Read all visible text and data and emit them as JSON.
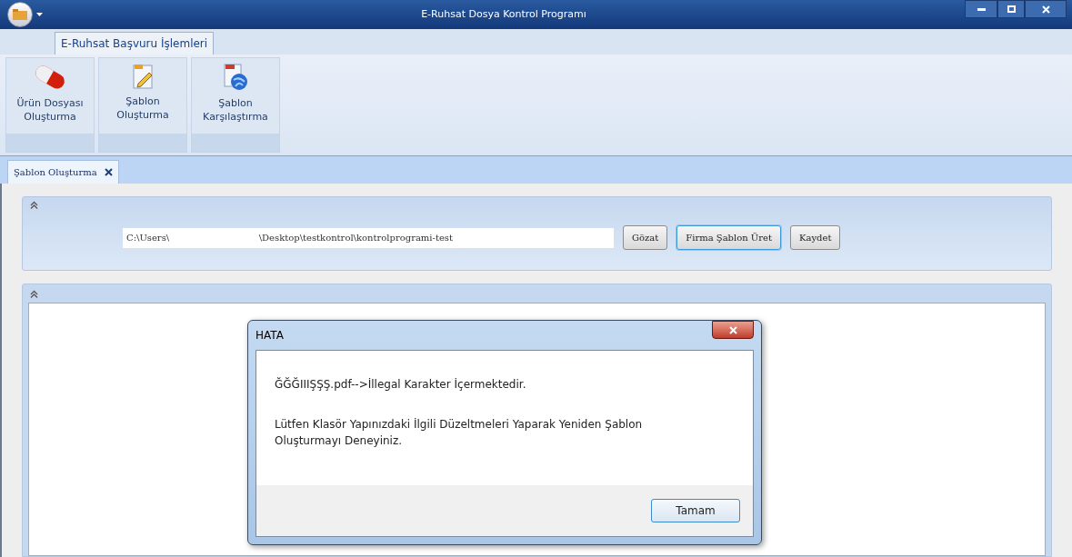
{
  "window": {
    "title": "E-Ruhsat Dosya Kontrol Programı"
  },
  "ribbon": {
    "tabs": [
      {
        "label": "E-Ruhsat Başvuru İşlemleri",
        "selected": true
      }
    ],
    "buttons": [
      {
        "label": "Ürün Dosyası Oluşturma",
        "kind": "pill"
      },
      {
        "label": "Şablon Oluşturma",
        "kind": "edit"
      },
      {
        "label": "Şablon Karşılaştırma",
        "kind": "globe"
      }
    ]
  },
  "doc_tabs": [
    {
      "label": "Şablon Oluşturma",
      "selected": true
    }
  ],
  "form": {
    "path_value": "C:\\Users\\                               \\Desktop\\testkontrol\\kontrolprogrami-test",
    "buttons": [
      {
        "label": "Gözat",
        "selected": false
      },
      {
        "label": "Firma Şablon Üret",
        "selected": true
      },
      {
        "label": "Kaydet",
        "selected": false
      }
    ]
  },
  "dialog": {
    "title": "HATA",
    "messages": [
      "ĞĞĞIIIŞŞŞ.pdf-->İllegal Karakter İçermektedir.",
      "Lütfen Klasör Yapınızdaki İlgili Düzeltmeleri Yaparak Yeniden Şablon Oluşturmayı Deneyiniz."
    ],
    "button": "Tamam"
  }
}
